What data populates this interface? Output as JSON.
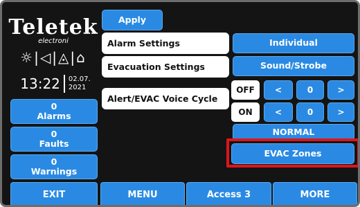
{
  "brand": {
    "name": "Teletek",
    "sub": "electroni"
  },
  "status_icons": "☼|◁|◬|⌂",
  "clock": {
    "time": "13:22",
    "date_line1": "02.07.",
    "date_line2": "2021"
  },
  "apply_label": "Apply",
  "settings": {
    "alarm": "Alarm Settings",
    "evacuation": "Evacuation Settings",
    "alert_evac": "Alert/EVAC Voice Cycle"
  },
  "options": {
    "alarm_value": "Individual",
    "evacuation_value": "Sound/Strobe",
    "off_label": "OFF",
    "on_label": "ON",
    "left_arrow": "<",
    "right_arrow": ">",
    "off_value": "0",
    "on_value": "0",
    "normal_label": "NORMAL",
    "evac_zones_label": "EVAC Zones"
  },
  "counters": [
    {
      "count": "0",
      "label": "Alarms"
    },
    {
      "count": "0",
      "label": "Faults"
    },
    {
      "count": "0",
      "label": "Warnings"
    }
  ],
  "bottom_bar": {
    "exit": "EXIT",
    "menu": "MENU",
    "access": "Access 3",
    "more": "MORE"
  },
  "colors": {
    "accent": "#2a8ae3",
    "highlight": "#e0141b",
    "background": "#141414"
  }
}
